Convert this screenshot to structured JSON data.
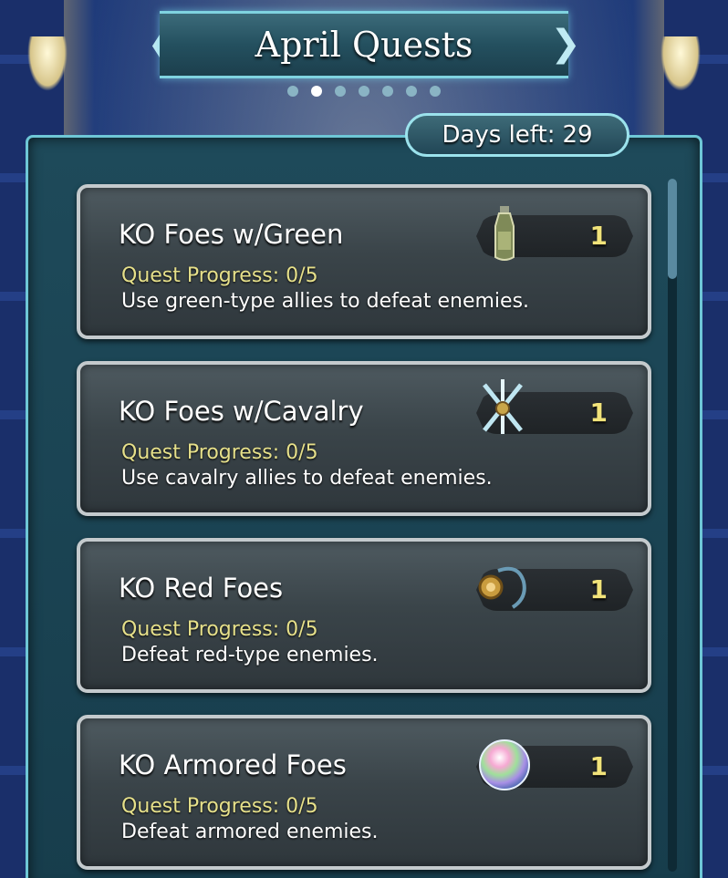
{
  "header": {
    "title": "April Quests",
    "page_count": 7,
    "active_page": 1
  },
  "days_left": {
    "label": "Days left:",
    "value": "29"
  },
  "quests": [
    {
      "title": "KO Foes w/Green",
      "progress": "Quest Progress: 0/5",
      "description": "Use green-type allies to defeat enemies.",
      "reward_icon": "potion-icon",
      "reward_count": "1"
    },
    {
      "title": "KO Foes w/Cavalry",
      "progress": "Quest Progress: 0/5",
      "description": "Use cavalry allies to defeat enemies.",
      "reward_icon": "crossed-weapons-icon",
      "reward_count": "1"
    },
    {
      "title": "KO Red Foes",
      "progress": "Quest Progress: 0/5",
      "description": "Defeat red-type enemies.",
      "reward_icon": "medallion-icon",
      "reward_count": "1"
    },
    {
      "title": "KO Armored Foes",
      "progress": "Quest Progress: 0/5",
      "description": "Defeat armored enemies.",
      "reward_icon": "orb-icon",
      "reward_count": "1"
    }
  ],
  "colors": {
    "progress_text": "#e6e08a",
    "reward_count": "#f1e37a",
    "panel_border": "#6ec7d6"
  }
}
